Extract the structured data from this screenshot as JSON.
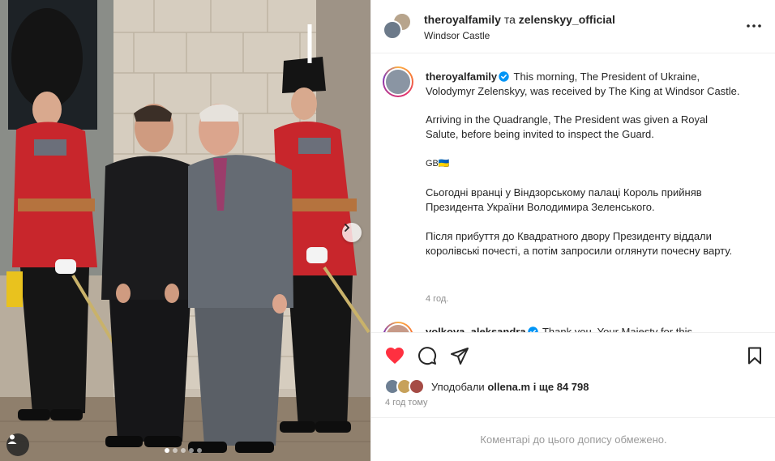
{
  "post": {
    "header": {
      "author": "theroyalfamily",
      "connector": "та",
      "coauthor": "zelenskyy_official",
      "location": "Windsor Castle"
    },
    "caption": {
      "username": "theroyalfamily",
      "paragraphs": [
        "This morning, The President of Ukraine, Volodymyr Zelenskyy, was received by The King at Windsor Castle.",
        "Arriving in the Quadrangle, The President was given a Royal Salute, before being invited to inspect the Guard.",
        "GB🇺🇦",
        "Сьогодні вранці у Віндзорському палаці Король прийняв Президента України Володимира Зеленського.",
        "Після прибуття до Квадратного двору Президенту віддали королівські почесті, а потім запросили оглянути почесну варту."
      ],
      "time": "4 год."
    },
    "next_comment": {
      "username": "volkova_aleksandra",
      "text": "Thank you, Your Majesty for this"
    },
    "likes": {
      "prefix": "Уподобали",
      "user": "ollena.m",
      "suffix": "і ще 84 798"
    },
    "timestamp": "4 год тому",
    "comments_limited": "Коментарі до цього допису обмежено."
  },
  "carousel": {
    "slides": 5,
    "active": 1
  },
  "icons": {
    "like": "heart-filled-icon",
    "comment": "comment-icon",
    "share": "paper-plane-icon",
    "save": "bookmark-icon",
    "more": "more-horizontal-icon",
    "next": "chevron-right-icon",
    "tags": "user-tag-icon",
    "verified": "verified-badge-icon"
  },
  "colors": {
    "like_red": "#ff3040",
    "verified_blue": "#0095f6",
    "muted_text": "#8e8e8e"
  }
}
